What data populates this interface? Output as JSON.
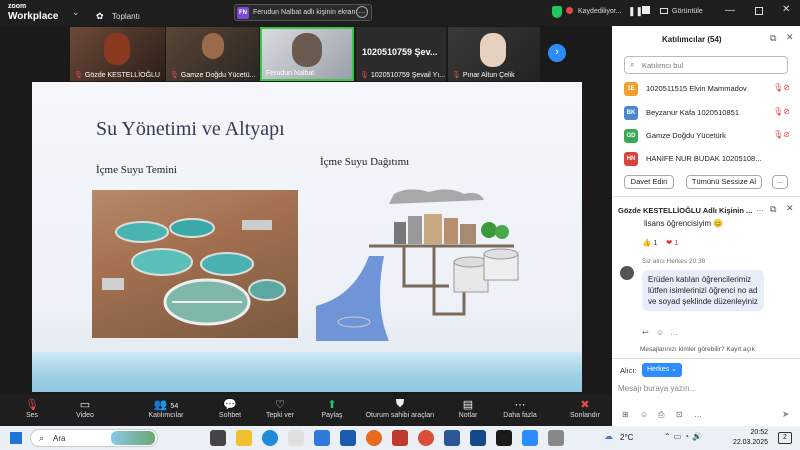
{
  "app": {
    "logo_line1": "zoom",
    "logo_line2": "Workplace"
  },
  "topbar": {
    "meeting_label": "Toplantı",
    "sharing_badge": "FN",
    "sharing_text": "Ferudun Nalbat adlı kişinin ekranı",
    "recording_text": "Kaydediliyor...",
    "view_label": "Görüntüle"
  },
  "thumbnails": [
    {
      "name": "Gözde KESTELLİOĞLU"
    },
    {
      "name": "Gamze Doğdu Yücetü..."
    },
    {
      "name": "Ferudun Nalbat"
    },
    {
      "name": "1020510759 Şevail Yı...",
      "title": "1020510759 Şev..."
    },
    {
      "name": "Pınar Altun Çelik"
    }
  ],
  "slide": {
    "title": "Su Yönetimi ve Altyapı",
    "subtitle_left": "İçme Suyu Temini",
    "subtitle_right": "İçme Suyu Dağıtımı"
  },
  "participants": {
    "title": "Katılımcılar (54)",
    "search_placeholder": "Katılımcı bul",
    "list": [
      {
        "initials": "1E",
        "name": "1020511515 Elvin Mammadov",
        "color": "#f0a030"
      },
      {
        "initials": "BK",
        "name": "Beyzanur Kafa 1020510851",
        "color": "#4a86c8"
      },
      {
        "initials": "GD",
        "name": "Gamze Doğdu Yücetürk",
        "color": "#3aa857"
      },
      {
        "initials": "HN",
        "name": "HANİFE NUR BUDAK 10205108...",
        "color": "#d9443a"
      }
    ],
    "invite_label": "Davet Edin",
    "mute_all_label": "Tümünü Sessize Al",
    "more_label": "..."
  },
  "chat": {
    "title": "Gözde KESTELLİOĞLU Adlı Kişinin ...",
    "prev_text": "lisans öğrencisiyim 😊",
    "reaction1": "👍 1",
    "reaction2": "❤ 1",
    "to_line": "Siz alıcı Herkes 20:38",
    "message": "Erüden katılan öğrencilerimiz lütfen isimlerinizi öğrenci no ad ve soyad şeklinde düzenleyiniz",
    "visibility_note": "Mesajlarınızı kimler görebilir? Kayıt açık",
    "recipient_label": "Alıcı:",
    "recipient_value": "Herkes",
    "input_placeholder": "Mesajı buraya yazın..."
  },
  "toolbar": {
    "items": [
      {
        "label": "Ses",
        "icon": "mic-muted-icon"
      },
      {
        "label": "Video",
        "icon": "video-icon"
      },
      {
        "label": "Katılımcılar",
        "icon": "participants-icon",
        "count": "54"
      },
      {
        "label": "Sohbet",
        "icon": "chat-icon"
      },
      {
        "label": "Tepki ver",
        "icon": "heart-icon"
      },
      {
        "label": "Paylaş",
        "icon": "share-icon"
      },
      {
        "label": "Oturum sahibi araçları",
        "icon": "shield-icon"
      },
      {
        "label": "Notlar",
        "icon": "notes-icon"
      },
      {
        "label": "Daha fazla",
        "icon": "more-icon"
      },
      {
        "label": "Sonlandır",
        "icon": "end-icon"
      }
    ]
  },
  "taskbar": {
    "search_label": "Ara",
    "weather": "2°C",
    "time": "20:52",
    "date": "22.03.2025",
    "notif": "2"
  },
  "colors": {
    "accent": "#2d8cff",
    "danger": "#e04a4a",
    "share_green": "#22c55e"
  }
}
